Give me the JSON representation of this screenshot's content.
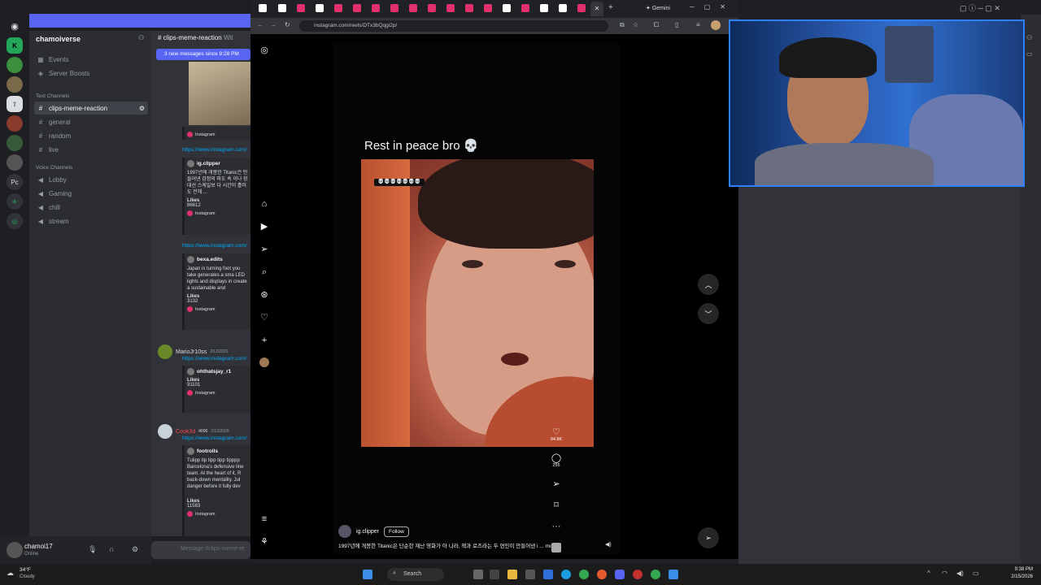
{
  "discord": {
    "server_name": "chamoiverse",
    "top_items": [
      "Events",
      "Server Boosts"
    ],
    "text_category": "Text Channels",
    "text_channels": [
      "clips-meme-reaction",
      "general",
      "random",
      "live"
    ],
    "voice_category": "Voice Channels",
    "voice_channels": [
      "Lobby",
      "Gaming",
      "chill",
      "stream"
    ],
    "header_channel": "clips-meme-reaction",
    "header_extra": "Wit",
    "new_messages_banner": "3 new messages since 9:28 PM",
    "link_text": "https://www.instagram.com/",
    "cards": [
      {
        "user": "ig.clipper",
        "text": "1997년에 개봉한 Titanic은 만들어낸 감정의 파도 속 이나 장대선 스케일보 다 시간이 흘러도 전해 ...",
        "likes_label": "Likes",
        "likes": "86612",
        "source": "Instagram"
      },
      {
        "user": "bexa.edits",
        "text": "Japan is turning foot you take generates a sma LED lights and displays in create a sustainable and",
        "likes_label": "Likes",
        "likes": "3132",
        "source": "Instagram"
      },
      {
        "user": "ohthatsjay_r1",
        "text": "",
        "likes_label": "Likes",
        "likes": "91101",
        "source": "Instagram"
      },
      {
        "user": "footrolls",
        "text": "Tulipp tip tipp tipp tipppp Barcelona's defensive line team. At the heart of it, R back-down mentality. Jul danger before it fully dev",
        "likes_label": "Likes",
        "likes": "11583",
        "source": "Instagram"
      }
    ],
    "authors": [
      {
        "name": "MarioJr10ss",
        "time": "2/12/2026",
        "color": "#dbdee1"
      },
      {
        "name": "Cook3d",
        "badge": "4000",
        "time": "2/12/2026",
        "color": "#f0484c"
      }
    ],
    "input_placeholder": "Message #clips-meme-re",
    "user": {
      "name": "chamoi17",
      "status": "Online"
    },
    "rail_labels": [
      "Pc"
    ]
  },
  "browser": {
    "url": "instagram.com/reels/DTx3bQqgi2p/",
    "tab_title": "Gemini"
  },
  "reel": {
    "top_caption": "Rest in peace bro 💀",
    "sticker_text": "💀💀💀💀💀💀💀",
    "likes": "94.8K",
    "comments": "255",
    "username": "ig.clipper",
    "follow_label": "Follow",
    "caption": "1997년에 개봉한 Titanic은 단순한 재난 영화가 아 니라, 잭과 로즈라는 두 연인이 만들어낸 i ... more"
  },
  "taskbar": {
    "weather_temp": "34°F",
    "weather_desc": "Cloudy",
    "search_label": "Search",
    "time": "9:38 PM",
    "date": "2/15/2026"
  },
  "colors": {
    "discord_bg": "#313338",
    "sidebar_bg": "#2b2d31",
    "blurple": "#5865f2",
    "link": "#00a8fc",
    "instagram_pink": "#e1306c"
  }
}
